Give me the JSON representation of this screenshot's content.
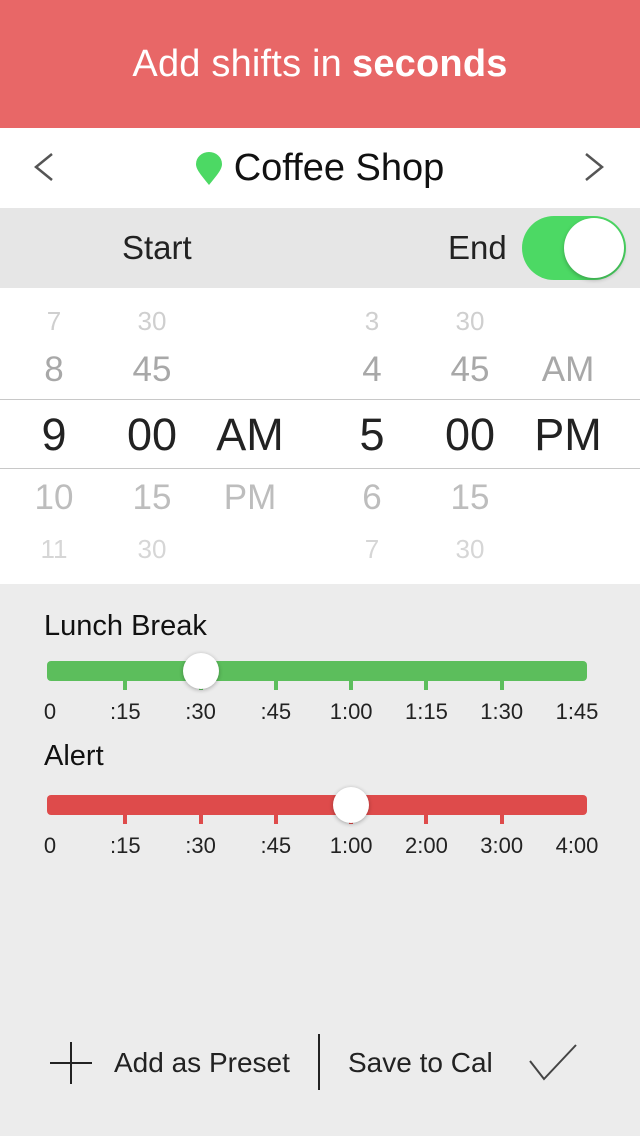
{
  "header": {
    "title_prefix": "Add shifts in",
    "title_bold": "seconds",
    "color": "#e86767"
  },
  "nav": {
    "prev_icon": "chevron-left-icon",
    "next_icon": "chevron-right-icon",
    "location_icon": "map-pin-icon",
    "location_name": "Coffee Shop",
    "pin_color": "#4cd964"
  },
  "time_bar": {
    "start_label": "Start",
    "end_label": "End",
    "end_toggle_on": true,
    "toggle_color": "#4cd964"
  },
  "picker": {
    "start": {
      "hour": [
        "7",
        "8",
        "9",
        "10",
        "11"
      ],
      "minute": [
        "30",
        "45",
        "00",
        "15",
        "30"
      ],
      "period": [
        "",
        "",
        "AM",
        "PM",
        ""
      ]
    },
    "end": {
      "hour": [
        "3",
        "4",
        "5",
        "6",
        "7"
      ],
      "minute": [
        "30",
        "45",
        "00",
        "15",
        "30"
      ],
      "period": [
        "",
        "AM",
        "PM",
        "",
        ""
      ]
    },
    "selected": {
      "start": "9:00 AM",
      "end": "5:00 PM"
    }
  },
  "lunch_break": {
    "label": "Lunch Break",
    "ticks": [
      "0",
      ":15",
      ":30",
      ":45",
      "1:00",
      "1:15",
      "1:30",
      "1:45"
    ],
    "selected_index": 2,
    "selected_value": ":30",
    "color": "#5cbe5c"
  },
  "alert": {
    "label": "Alert",
    "ticks": [
      "0",
      ":15",
      ":30",
      ":45",
      "1:00",
      "2:00",
      "3:00",
      "4:00"
    ],
    "selected_index": 4,
    "selected_value": "1:00",
    "color": "#de4b4b"
  },
  "toolbar": {
    "add_preset_label": "Add as Preset",
    "add_preset_icon": "plus-icon",
    "save_label": "Save to Cal",
    "confirm_icon": "checkmark-icon"
  }
}
